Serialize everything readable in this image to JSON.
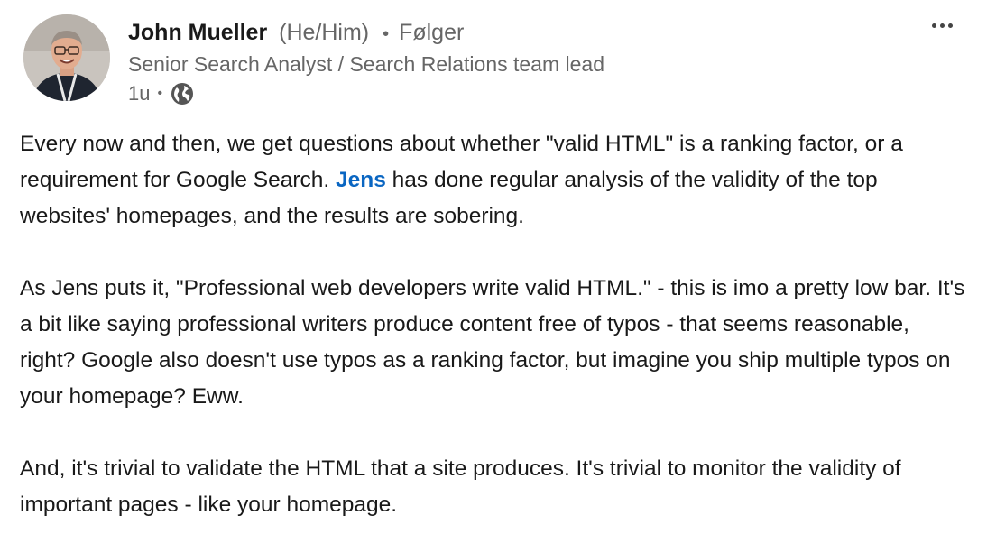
{
  "author": {
    "name": "John Mueller",
    "pronouns": "(He/Him)",
    "separator": "•",
    "follow_status": "Følger",
    "headline": "Senior Search Analyst / Search Relations team lead",
    "time": "1u",
    "visibility_icon": "globe-icon"
  },
  "menu": {
    "icon": "more-horizontal-icon"
  },
  "post": {
    "p1_before": "Every now and then, we get questions about whether \"valid HTML\" is a ranking factor, or a requirement for Google Search. ",
    "p1_mention": "Jens",
    "p1_after": " has done regular analysis of the validity of the top websites' homepages, and the results are sobering.",
    "p2": "As Jens puts it, \"Professional web developers write valid HTML.\" - this is imo a pretty low bar. It's a bit like saying professional writers produce content free of typos - that seems reasonable, right? Google also doesn't use typos as a ranking factor, but imagine you ship multiple typos on your homepage? Eww.",
    "p3": "And, it's trivial to validate the HTML that a site produces. It's trivial to monitor the validity of important pages - like your homepage."
  },
  "colors": {
    "mention": "#0a66c2",
    "secondary_text": "#666666",
    "primary_text": "#191919"
  }
}
